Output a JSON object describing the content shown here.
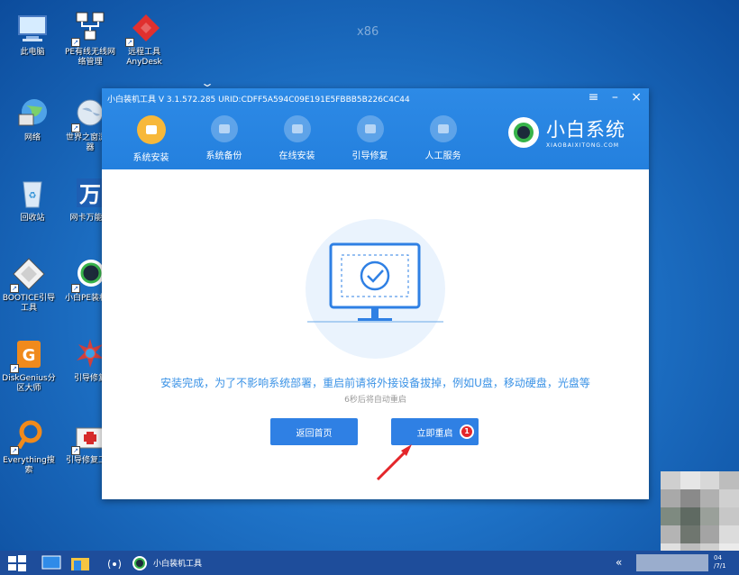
{
  "desktop": {
    "watermark": "x86",
    "icons": [
      {
        "label": "此电脑"
      },
      {
        "label": "PE有线无线网络管理"
      },
      {
        "label": "远程工具AnyDesk"
      },
      {
        "label": "网络"
      },
      {
        "label": "世界之窗浏览器"
      },
      {
        "label": "回收站"
      },
      {
        "label": "网卡万能驱"
      },
      {
        "label": "BOOTICE引导工具"
      },
      {
        "label": "小白PE装机具"
      },
      {
        "label": "DiskGenius分区大师"
      },
      {
        "label": "引导修复"
      },
      {
        "label": "Everything搜索"
      },
      {
        "label": "引导修复工具"
      }
    ]
  },
  "window": {
    "title": "小白装机工具 V 3.1.572.285 URID:CDFF5A594C09E191E5FBBB5B226C4C44",
    "controls": {
      "menu": "≡",
      "minimize": "–",
      "close": "×"
    },
    "tabs": [
      {
        "label": "系统安装",
        "active": true
      },
      {
        "label": "系统备份",
        "active": false
      },
      {
        "label": "在线安装",
        "active": false
      },
      {
        "label": "引导修复",
        "active": false
      },
      {
        "label": "人工服务",
        "active": false
      }
    ],
    "brand": {
      "name": "小白系统",
      "sub": "XIAOBAIXITONG.COM"
    },
    "message": "安装完成，为了不影响系统部署，重启前请将外接设备拔掉，例如U盘，移动硬盘，光盘等",
    "countdown": "6秒后将自动重启",
    "buttons": {
      "home": "返回首页",
      "restart": "立即重启",
      "badge": "1"
    }
  },
  "taskbar": {
    "app_label": "小白装机工具",
    "tray_arrow": "«",
    "clock_line1": "04",
    "clock_line2": "/7/1"
  },
  "colors": {
    "accent": "#2f80e4",
    "header": "#2480de",
    "active_tab": "#f7b83a",
    "badge": "#e4262a",
    "message": "#3a92e6"
  }
}
